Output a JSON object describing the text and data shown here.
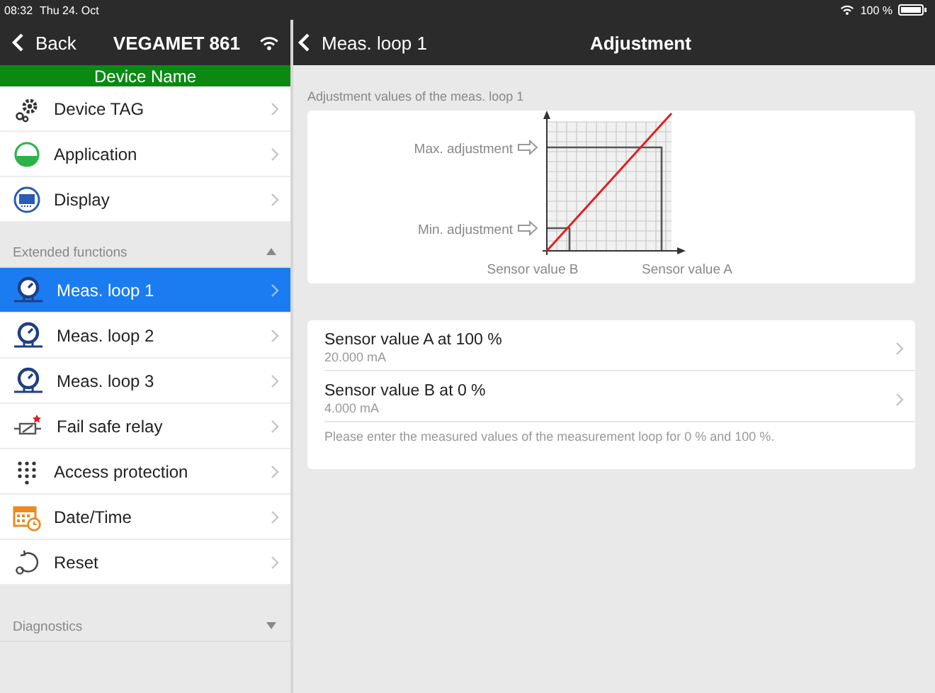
{
  "status_bar": {
    "time": "08:32",
    "date": "Thu 24. Oct",
    "battery": "100 %"
  },
  "left_nav": {
    "back": "Back",
    "title": "VEGAMET 861"
  },
  "device_name": "Device Name",
  "menu_items": [
    {
      "label": "Device TAG",
      "selected": false
    },
    {
      "label": "Application",
      "selected": false
    },
    {
      "label": "Display",
      "selected": false
    }
  ],
  "sections": [
    {
      "title": "Extended functions",
      "expanded": true,
      "items": [
        {
          "label": "Meas. loop 1",
          "selected": true
        },
        {
          "label": "Meas. loop 2",
          "selected": false
        },
        {
          "label": "Meas. loop 3",
          "selected": false
        },
        {
          "label": "Fail safe relay",
          "selected": false
        },
        {
          "label": "Access protection",
          "selected": false
        },
        {
          "label": "Date/Time",
          "selected": false
        },
        {
          "label": "Reset",
          "selected": false
        }
      ]
    },
    {
      "title": "Diagnostics",
      "expanded": false
    }
  ],
  "right_nav": {
    "back": "Meas. loop 1",
    "title": "Adjustment"
  },
  "caption": "Adjustment values of the meas. loop 1",
  "diagram": {
    "max_label": "Max. adjustment",
    "min_label": "Min. adjustment",
    "sensor_b": "Sensor value B",
    "sensor_a": "Sensor value A"
  },
  "values": [
    {
      "label": "Sensor value A at 100 %",
      "value": "20.000 mA"
    },
    {
      "label": "Sensor value B at 0 %",
      "value": "4.000 mA"
    }
  ],
  "hint": "Please enter the measured values of the measurement loop for 0 % and 100 %."
}
